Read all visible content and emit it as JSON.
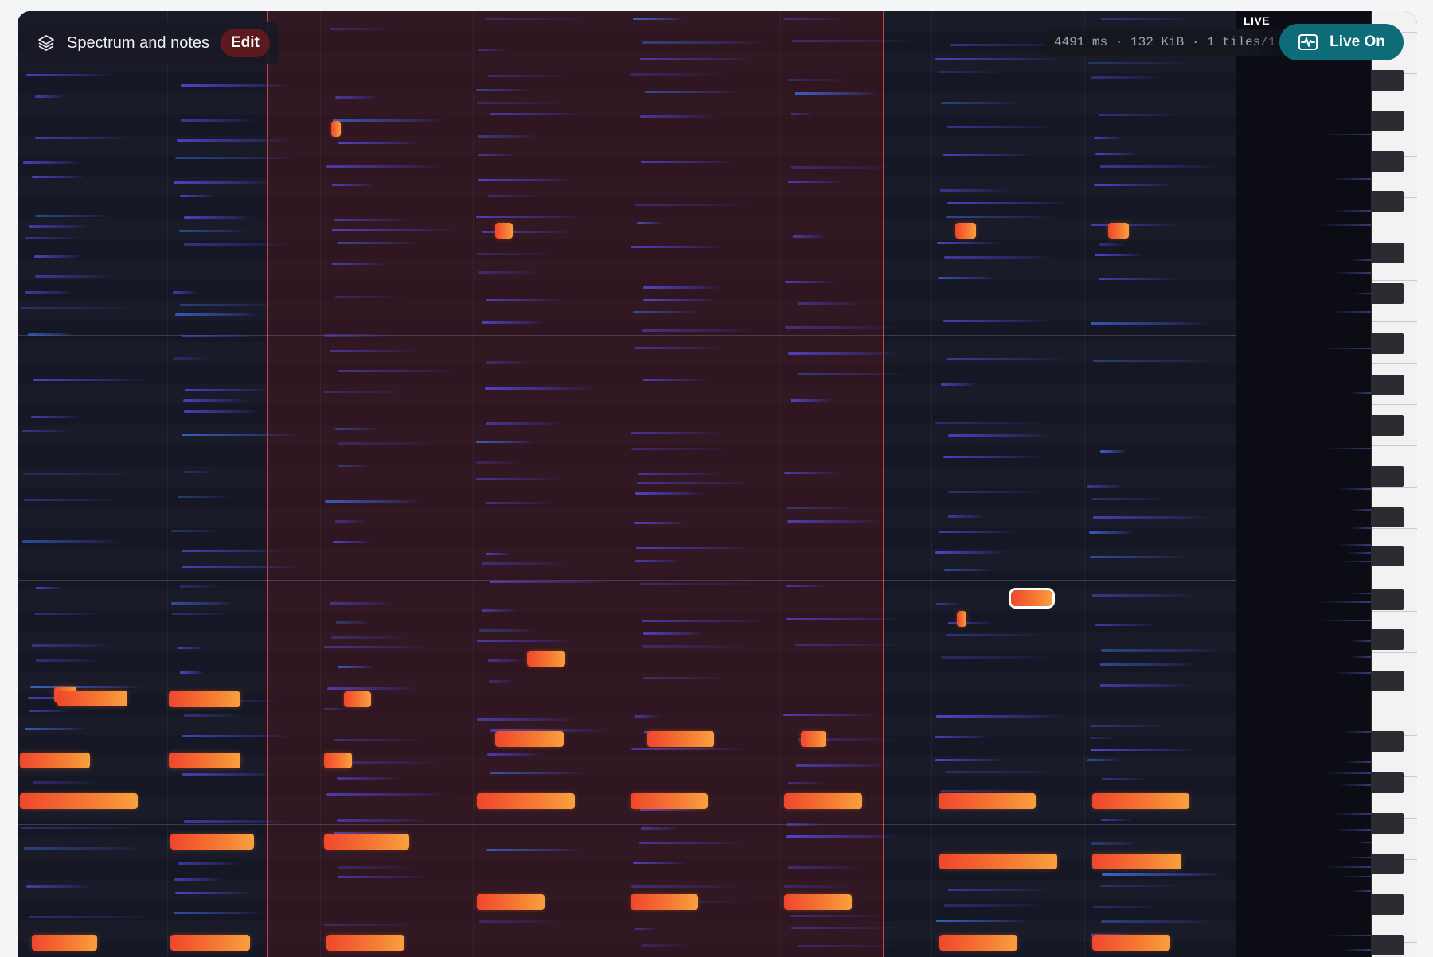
{
  "header": {
    "title": "Spectrum and notes",
    "edit_label": "Edit",
    "icon": "layers-icon"
  },
  "status": {
    "stats": "4491 ms · 132 KiB · 1 tiles/1",
    "live_label": "LIVE",
    "live_button": "Live On",
    "live_icon": "waveform-icon"
  },
  "colors": {
    "note": "#f5743a",
    "selection": "#c8423f",
    "live_button": "#0e6c78",
    "edit_button": "#5c1a1e",
    "spectrum": "#5848dc"
  },
  "piano_roll": {
    "selected_note_index": 10,
    "notes_count": 41
  }
}
